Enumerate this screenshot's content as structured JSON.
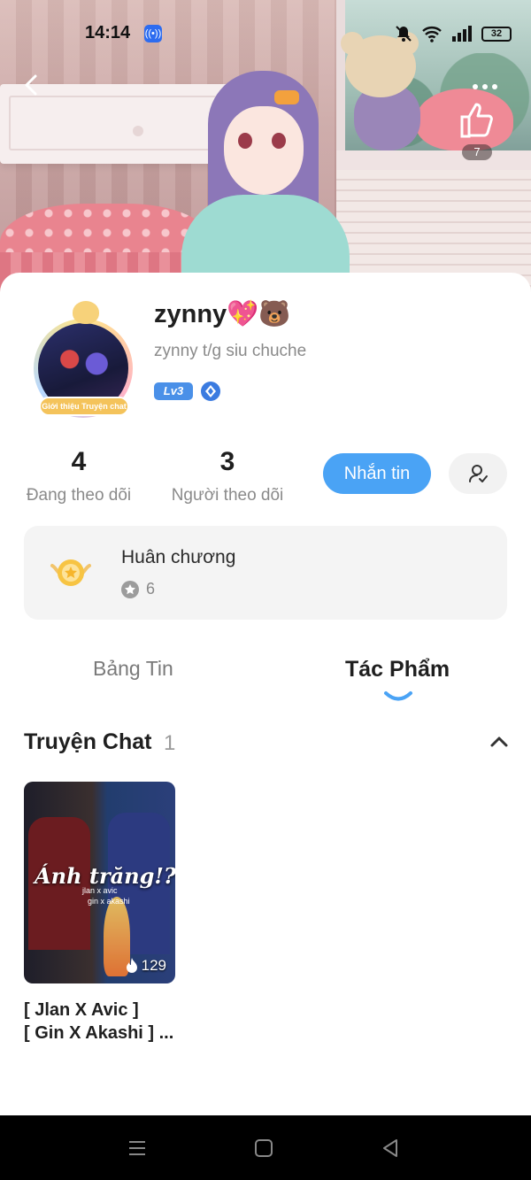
{
  "status_bar": {
    "time": "14:14",
    "battery": "32",
    "icons": [
      "broadcast-icon",
      "bell-off-icon",
      "wifi-icon",
      "signal-icon",
      "battery-icon"
    ]
  },
  "header": {
    "like_count": "7",
    "icons": [
      "back-arrow-icon",
      "more-dots-icon",
      "thumbs-up-icon"
    ]
  },
  "profile": {
    "name": "zynny💖🐻",
    "bio": "zynny t/g siu chuche",
    "level": "Lv3",
    "avatar_banner": "Giới thiệu Truyện chat"
  },
  "stats": {
    "following_count": "4",
    "following_label": "Đang theo dõi",
    "followers_count": "3",
    "followers_label": "Người theo dõi"
  },
  "actions": {
    "message_label": "Nhắn tin",
    "follow_icon": "user-check-icon"
  },
  "medals": {
    "title": "Huân chương",
    "count": "6"
  },
  "tabs": [
    {
      "label": "Bảng Tin",
      "active": false
    },
    {
      "label": "Tác Phẩm",
      "active": true
    }
  ],
  "section": {
    "title": "Truyện Chat",
    "count": "1"
  },
  "stories": [
    {
      "cover_text": "Ánh trăng!?",
      "cover_sub1": "jlan x avic",
      "cover_sub2": "gin x akashi",
      "views": "129",
      "title_line1": "[ Jlan X Avic ]",
      "title_line2": "[ Gin X Akashi ] ..."
    }
  ],
  "colors": {
    "accent_blue": "#4aa3f5",
    "level_blue": "#4a90e8",
    "medal_bg": "#f4f4f4"
  }
}
